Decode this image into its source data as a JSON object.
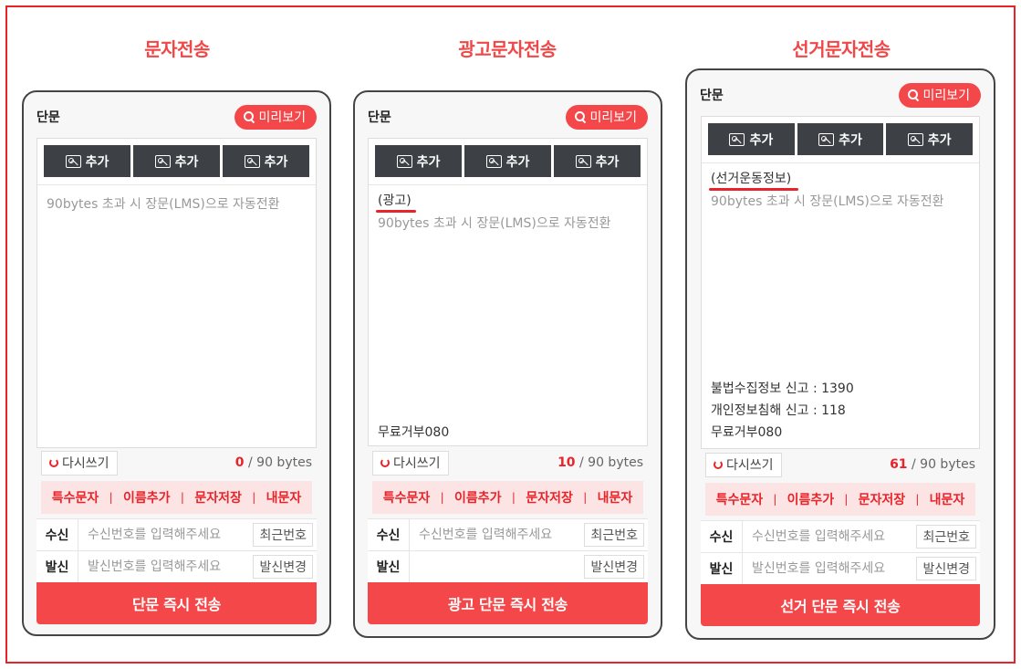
{
  "titles": [
    "문자전송",
    "광고문자전송",
    "선거문자전송"
  ],
  "phones": [
    {
      "type_label": "단문",
      "preview_label": "미리보기",
      "image_buttons": [
        "추가",
        "추가",
        "추가"
      ],
      "prefix": "",
      "placeholder": "90bytes 초과 시 장문(LMS)으로 자동전환",
      "footer_lines": [],
      "rewrite_label": "다시쓰기",
      "byte_count": "0",
      "byte_limit": "/ 90 bytes",
      "actions": [
        "특수문자",
        "이름추가",
        "문자저장",
        "내문자"
      ],
      "recipient_label": "수신",
      "recipient_placeholder": "수신번호를 입력해주세요",
      "recent_label": "최근번호",
      "sender_label": "발신",
      "sender_placeholder": "발신번호를 입력해주세요",
      "change_label": "발신변경",
      "send_label": "단문 즉시 전송"
    },
    {
      "type_label": "단문",
      "preview_label": "미리보기",
      "image_buttons": [
        "추가",
        "추가",
        "추가"
      ],
      "prefix": "(광고)",
      "placeholder": "90bytes 초과 시 장문(LMS)으로 자동전환",
      "footer_lines": [
        "무료거부080"
      ],
      "rewrite_label": "다시쓰기",
      "byte_count": "10",
      "byte_limit": "/ 90 bytes",
      "actions": [
        "특수문자",
        "이름추가",
        "문자저장",
        "내문자"
      ],
      "recipient_label": "수신",
      "recipient_placeholder": "수신번호를 입력해주세요",
      "recent_label": "최근번호",
      "sender_label": "발신",
      "sender_placeholder": "",
      "change_label": "발신변경",
      "send_label": "광고 단문 즉시 전송"
    },
    {
      "type_label": "단문",
      "preview_label": "미리보기",
      "image_buttons": [
        "추가",
        "추가",
        "추가"
      ],
      "prefix": "(선거운동정보)",
      "placeholder": "90bytes 초과 시 장문(LMS)으로 자동전환",
      "footer_lines": [
        "불법수집정보 신고 : 1390",
        "개인정보침해 신고 : 118",
        "무료거부080"
      ],
      "rewrite_label": "다시쓰기",
      "byte_count": "61",
      "byte_limit": "/ 90 bytes",
      "actions": [
        "특수문자",
        "이름추가",
        "문자저장",
        "내문자"
      ],
      "recipient_label": "수신",
      "recipient_placeholder": "수신번호를 입력해주세요",
      "recent_label": "최근번호",
      "sender_label": "발신",
      "sender_placeholder": "발신번호를 입력해주세요",
      "change_label": "발신변경",
      "send_label": "선거 단문 즉시 전송"
    }
  ],
  "colors": {
    "accent": "#f4474a",
    "frame": "#e8232a",
    "dark_button": "#3d4145",
    "action_bg": "#fde4e4"
  }
}
